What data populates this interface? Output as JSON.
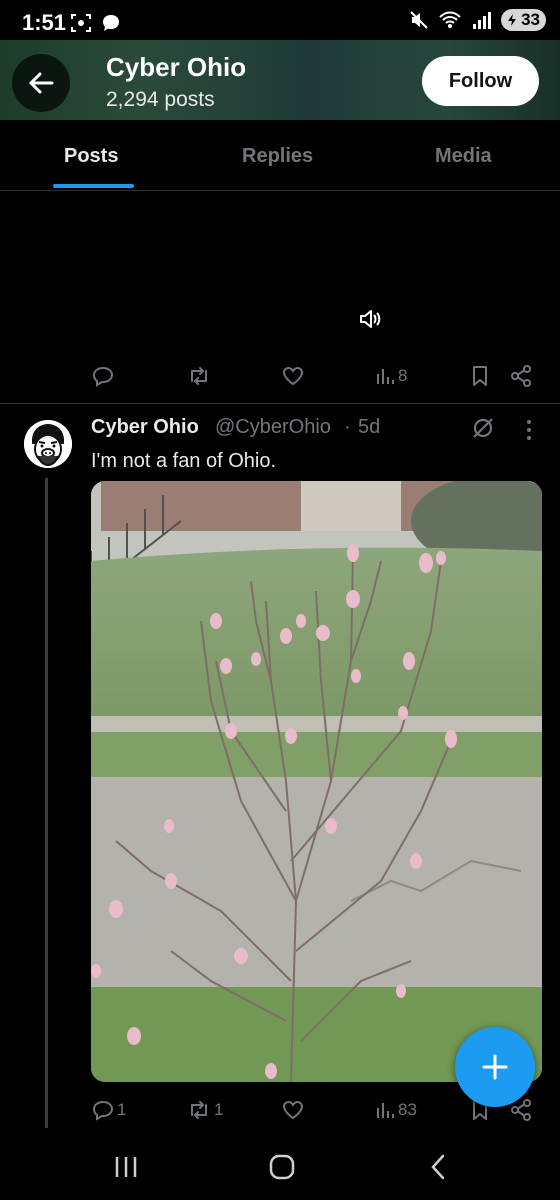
{
  "status_bar": {
    "time": "1:51",
    "signal_label": "5",
    "battery": "33"
  },
  "header": {
    "name": "Cyber Ohio",
    "post_count": "2,294 posts",
    "follow_label": "Follow"
  },
  "tabs": [
    {
      "label": "Posts",
      "active": true
    },
    {
      "label": "Replies",
      "active": false
    },
    {
      "label": "Media",
      "active": false
    }
  ],
  "post1": {
    "actions": {
      "reply": "",
      "repost": "",
      "like": "",
      "views": "8"
    }
  },
  "post2": {
    "name": "Cyber Ohio",
    "handle": "@CyberOhio",
    "separator": "·",
    "time": "5d",
    "text": "I'm not a fan of Ohio.",
    "actions": {
      "reply": "1",
      "repost": "1",
      "like": "",
      "views": "83"
    }
  },
  "icons": {
    "back": "arrow-left-icon",
    "compose": "plus-icon",
    "accent": "#1d9bf0"
  }
}
